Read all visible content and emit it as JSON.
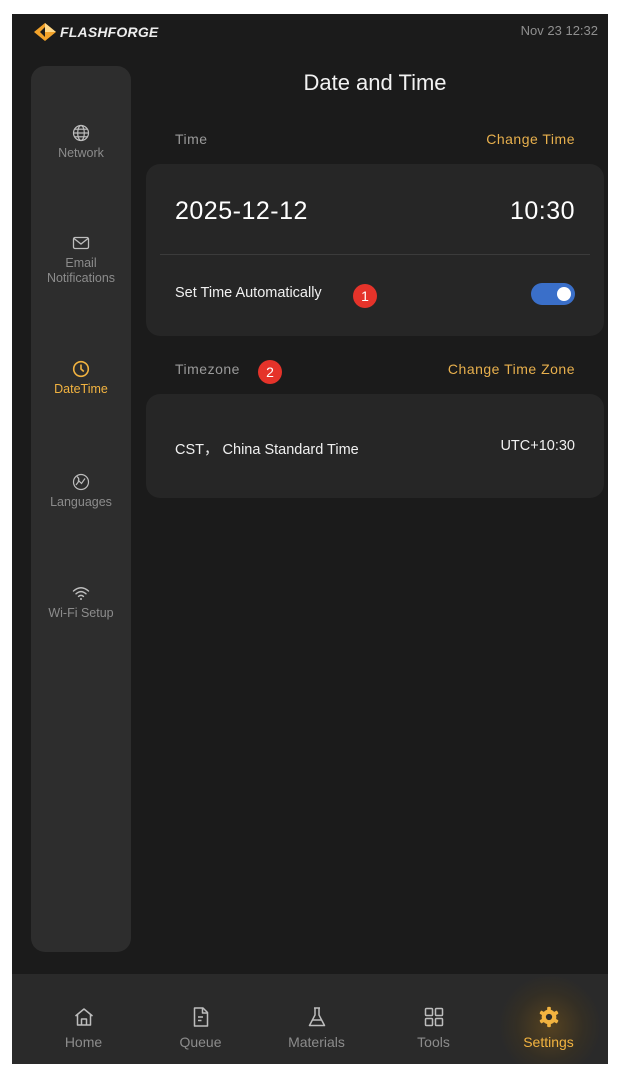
{
  "status": {
    "brand": "FLASHFORGE",
    "datetime": "Nov 23  12:32"
  },
  "page": {
    "title": "Date and Time"
  },
  "sidebar": {
    "items": [
      {
        "label": "Network",
        "icon": "globe-icon"
      },
      {
        "label": "Email Notifications",
        "icon": "mail-icon"
      },
      {
        "label": "DateTime",
        "icon": "clock-icon",
        "active": true
      },
      {
        "label": "Languages",
        "icon": "languages-icon"
      },
      {
        "label": "Wi-Fi Setup",
        "icon": "wifi-icon"
      }
    ]
  },
  "time_section": {
    "label": "Time",
    "action": "Change Time",
    "date": "2025-12-12",
    "time": "10:30",
    "auto_label": "Set Time Automatically",
    "auto_enabled": true,
    "badge": "1"
  },
  "timezone_section": {
    "label": "Timezone",
    "action": "Change Time Zone",
    "badge": "2",
    "name": "CST， China Standard Time",
    "offset": "UTC+10:30"
  },
  "bottom_nav": {
    "items": [
      {
        "label": "Home",
        "icon": "home-icon"
      },
      {
        "label": "Queue",
        "icon": "document-icon"
      },
      {
        "label": "Materials",
        "icon": "flask-icon"
      },
      {
        "label": "Tools",
        "icon": "grid-icon"
      },
      {
        "label": "Settings",
        "icon": "gear-icon",
        "active": true
      }
    ]
  },
  "colors": {
    "background": "#1b1b1b",
    "sidebar": "#2d2d2d",
    "card": "#262626",
    "accent": "#f2b340",
    "link": "#e8b04d",
    "toggle_on": "#3a6fc9",
    "badge": "#e5332a"
  }
}
